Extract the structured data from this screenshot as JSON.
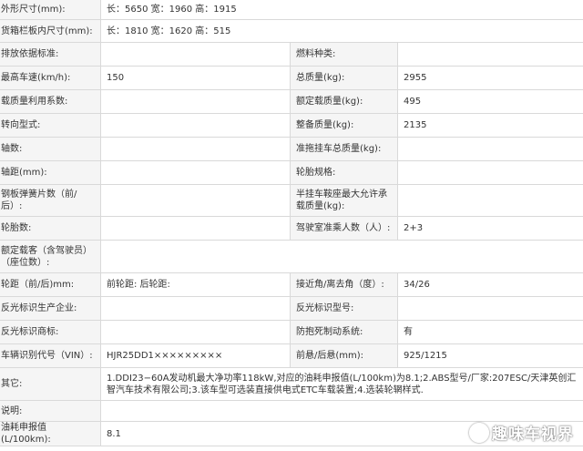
{
  "rows": {
    "outer_size": {
      "label": "外形尺寸(mm):",
      "value": "长：5650 宽：1960 高：1915"
    },
    "cargo_size": {
      "label": "货箱栏板内尺寸(mm):",
      "value": "长：1810 宽：1620 高：515"
    },
    "emission": {
      "label": "排放依据标准:",
      "value": "",
      "label2": "燃料种类:",
      "value2": ""
    },
    "speed": {
      "label": "最高车速(km/h):",
      "value": "150",
      "label2": "总质量(kg):",
      "value2": "2955"
    },
    "load_util": {
      "label": "载质量利用系数:",
      "value": "",
      "label2": "额定载质量(kg):",
      "value2": "495"
    },
    "steering": {
      "label": "转向型式:",
      "value": "",
      "label2": "整备质量(kg):",
      "value2": "2135"
    },
    "axles": {
      "label": "轴数:",
      "value": "",
      "label2": "准拖挂车总质量(kg):",
      "value2": ""
    },
    "wheelbase": {
      "label": "轴距(mm):",
      "value": "",
      "label2": "轮胎规格:",
      "value2": ""
    },
    "springs": {
      "label": "钢板弹簧片数（前/后）:",
      "value": "",
      "label2": "半挂车鞍座最大允许承载质量(kg):",
      "value2": ""
    },
    "tires": {
      "label": "轮胎数:",
      "value": "",
      "label2": "驾驶室准乘人数（人）:",
      "value2": "2+3"
    },
    "passengers": {
      "label": "额定载客（含驾驶员）（座位数）:",
      "value": ""
    },
    "track": {
      "label": "轮距（前/后)mm:",
      "value": "前轮距: 后轮距:",
      "label2": "接近角/离去角（度）:",
      "value2": "34/26"
    },
    "reflector_mfr": {
      "label": "反光标识生产企业:",
      "value": "",
      "label2": "反光标识型号:",
      "value2": ""
    },
    "reflector_brand": {
      "label": "反光标识商标:",
      "value": "",
      "label2": "防抱死制动系统:",
      "value2": "有"
    },
    "vin": {
      "label": "车辆识别代号（VIN）:",
      "value": "HJR25DD1×××××××××",
      "label2": "前悬/后悬(mm):",
      "value2": "925/1215"
    },
    "other": {
      "label": "其它:",
      "value": "1.DDI23−60A发动机最大净功率118kW,对应的油耗申报值(L/100km)为8.1;2.ABS型号/厂家:207ESC/天津英创汇智汽车技术有限公司;3.该车型可选装直接供电式ETC车载装置;4.选装轮辋样式."
    },
    "note": {
      "label": "说明:",
      "value": ""
    },
    "fuel": {
      "label": "油耗申报值(L/100km):",
      "value": "8.1"
    }
  },
  "watermark": {
    "text": "趣味车视界",
    "icon": "play-circle-icon"
  }
}
